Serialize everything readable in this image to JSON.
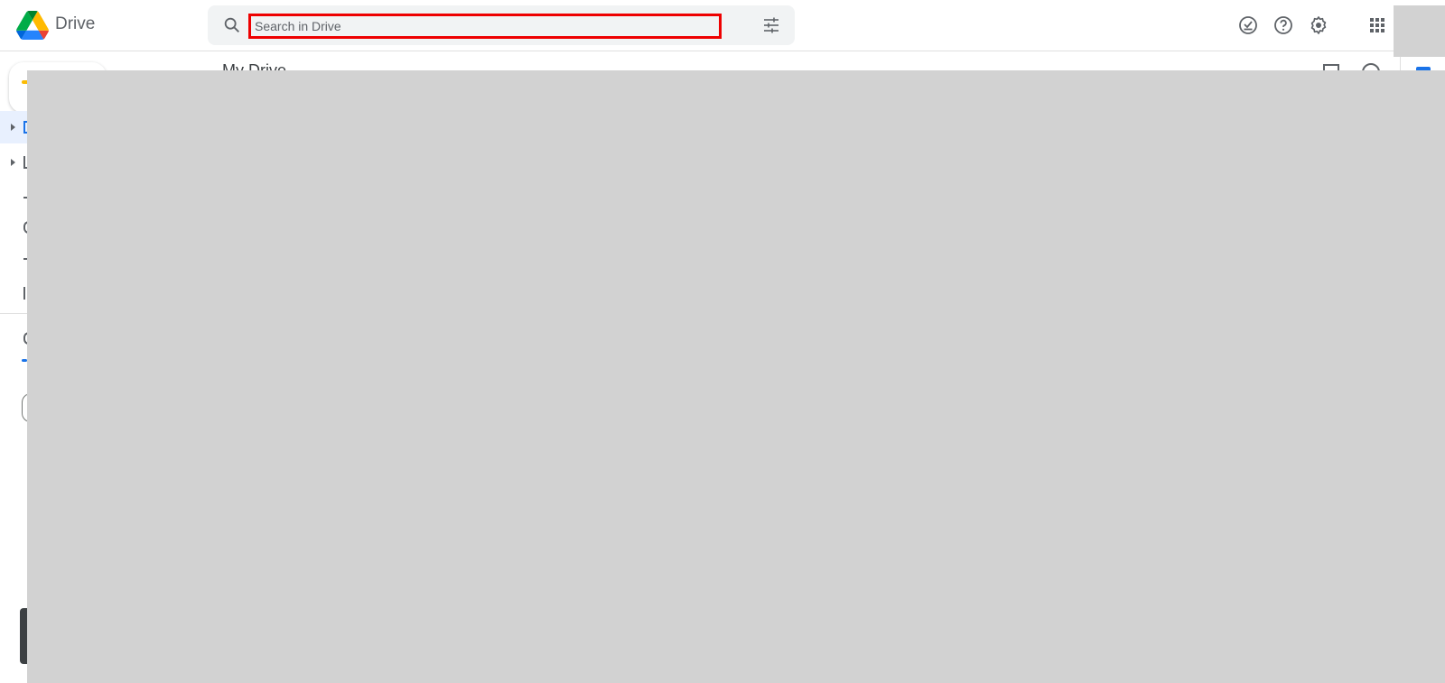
{
  "app": {
    "brand": "Drive",
    "logo_icon": "google-drive-logo"
  },
  "search": {
    "placeholder": "Search in Drive",
    "value": "",
    "search_icon": "search-icon",
    "filter_icon": "search-options-icon",
    "highlight_color": "#ee0000"
  },
  "toolbar": {
    "icons": [
      "offline-ready-icon",
      "help-icon",
      "settings-icon",
      "apps-grid-icon"
    ]
  },
  "main": {
    "title": "My Drive",
    "view_icon": "grid-view-icon",
    "info_icon": "info-icon"
  },
  "sidebar": {
    "new_button_icon": "plus-icon",
    "accent": "#1a73e8"
  },
  "colors": {
    "overlay": "#d2d2d2",
    "search_bg": "#f1f3f4",
    "active_nav_bg": "#e8f0fe"
  }
}
